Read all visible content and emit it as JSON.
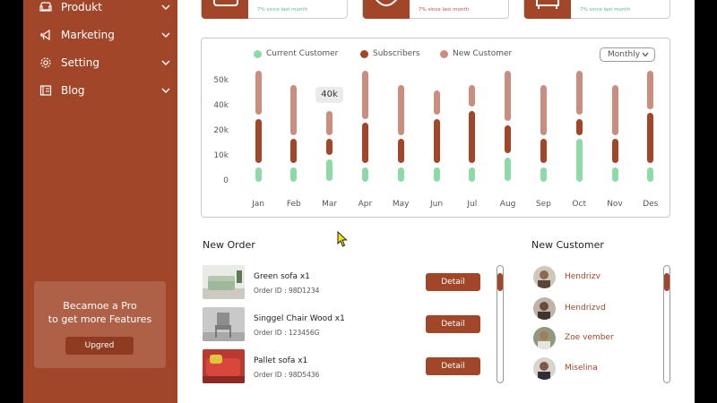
{
  "sidebar": {
    "items": [
      {
        "label": "Produkt",
        "icon": "sofa-icon"
      },
      {
        "label": "Marketing",
        "icon": "megaphone-icon"
      },
      {
        "label": "Setting",
        "icon": "gear-icon"
      },
      {
        "label": "Blog",
        "icon": "blog-icon"
      }
    ],
    "promo": {
      "line1": "Becamoe a Pro",
      "line2": "to get more Features",
      "button": "Upgred"
    }
  },
  "stats": [
    {
      "trend": "7% since last month",
      "direction": "up"
    },
    {
      "trend": "7% since last month",
      "direction": "down"
    },
    {
      "trend": "7% since last month",
      "direction": "up"
    }
  ],
  "chart_data": {
    "type": "bar",
    "legend": [
      "Current Customer",
      "Subscribers",
      "New Customer"
    ],
    "colors": {
      "Current Customer": "#8ed9a8",
      "Subscribers": "#a14629",
      "New Customer": "#c98e80"
    },
    "period_select": "Monthly",
    "y_ticks": [
      "50k",
      "40k",
      "20k",
      "10k",
      "0"
    ],
    "categories": [
      "Jan",
      "Feb",
      "Mar",
      "Apr",
      "May",
      "Jun",
      "Jul",
      "Aug",
      "Sep",
      "Oct",
      "Nov",
      "Des"
    ],
    "tooltip": "40k",
    "series": [
      {
        "name": "Current Customer",
        "segments": [
          [
            2,
            9
          ],
          [
            2,
            9
          ],
          [
            2,
            13
          ],
          [
            2,
            9
          ],
          [
            2,
            9
          ],
          [
            2,
            9
          ],
          [
            2,
            9
          ],
          [
            2,
            14
          ],
          [
            2,
            9
          ],
          [
            2,
            23
          ],
          [
            2,
            9
          ],
          [
            2,
            9
          ]
        ]
      },
      {
        "name": "Subscribers",
        "segments": [
          [
            11,
            33
          ],
          [
            11,
            23
          ],
          [
            15,
            23
          ],
          [
            11,
            31
          ],
          [
            11,
            23
          ],
          [
            11,
            33
          ],
          [
            11,
            37
          ],
          [
            16,
            30
          ],
          [
            11,
            23
          ],
          [
            25,
            33
          ],
          [
            11,
            23
          ],
          [
            11,
            36
          ]
        ]
      },
      {
        "name": "New Customer",
        "segments": [
          [
            35,
            57
          ],
          [
            25,
            50
          ],
          [
            25,
            37
          ],
          [
            33,
            57
          ],
          [
            25,
            50
          ],
          [
            35,
            47
          ],
          [
            39,
            50
          ],
          [
            32,
            57
          ],
          [
            25,
            50
          ],
          [
            35,
            57
          ],
          [
            25,
            50
          ],
          [
            38,
            57
          ]
        ]
      }
    ]
  },
  "orders": {
    "title": "New Order",
    "items": [
      {
        "name": "Green sofa  x1",
        "order_id": "Order ID : 98D1234",
        "button": "Detail"
      },
      {
        "name": "Singgel Chair Wood  x1",
        "order_id": "Order ID : 123456G",
        "button": "Detail"
      },
      {
        "name": "Pallet sofa x1",
        "order_id": "Order ID : 98D5436",
        "button": "Detail"
      }
    ]
  },
  "customers": {
    "title": "New Customer",
    "items": [
      {
        "name": "Hendrizv"
      },
      {
        "name": "Hendrizvd"
      },
      {
        "name": "Zoe vember"
      },
      {
        "name": "Miselina"
      }
    ]
  }
}
